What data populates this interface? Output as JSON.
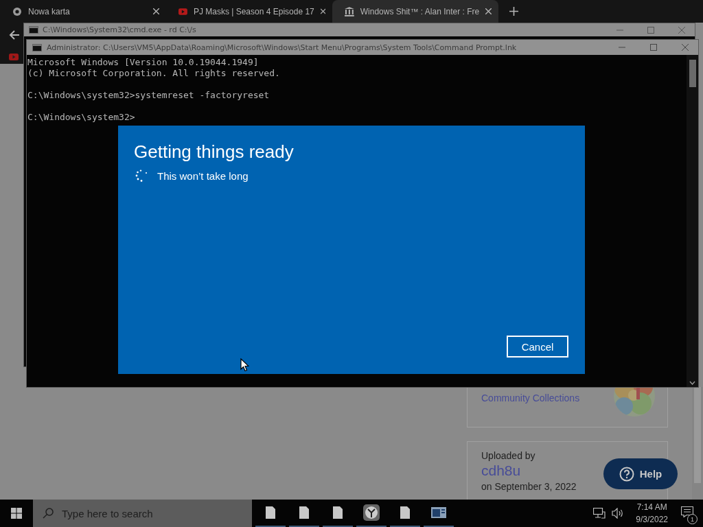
{
  "browser": {
    "tabs": [
      {
        "title": "Nowa karta",
        "kind": "chrome",
        "selected": false
      },
      {
        "title": "PJ Masks | Season 4 Episode 17",
        "kind": "video",
        "selected": false
      },
      {
        "title": "Windows Shit™ : Alan Inter : Fre",
        "kind": "archive",
        "selected": true
      }
    ]
  },
  "page": {
    "collections_link": "Community Collections",
    "uploader_label": "Uploaded by",
    "uploader_name": "cdh8u",
    "upload_date": "on September 3, 2022",
    "help_button": "Help"
  },
  "cmd_back": {
    "title": "C:\\Windows\\System32\\cmd.exe - rd  C:\\/s"
  },
  "cmd_front": {
    "title": "Administrator: C:\\Users\\VM5\\AppData\\Roaming\\Microsoft\\Windows\\Start Menu\\Programs\\System Tools\\Command Prompt.lnk",
    "lines": [
      {
        "text": "Microsoft Windows [Version 10.0.19044.1949]",
        "kind": "output"
      },
      {
        "text": "(c) Microsoft Corporation. All rights reserved.",
        "kind": "output"
      },
      {
        "text": "C:\\Windows\\system32>systemreset -factoryreset",
        "kind": "prompt"
      },
      {
        "text": "C:\\Windows\\system32>",
        "kind": "prompt"
      }
    ]
  },
  "dialog": {
    "title": "Getting things ready",
    "message": "This won’t take long",
    "cancel_button": "Cancel"
  },
  "taskbar": {
    "search_placeholder": "Type here to search",
    "apps": [
      {
        "kind": "file"
      },
      {
        "kind": "file"
      },
      {
        "kind": "file"
      },
      {
        "kind": "clock"
      },
      {
        "kind": "file"
      },
      {
        "kind": "window"
      }
    ],
    "time": "7:14 AM",
    "date": "9/3/2022",
    "notifications": "1"
  }
}
